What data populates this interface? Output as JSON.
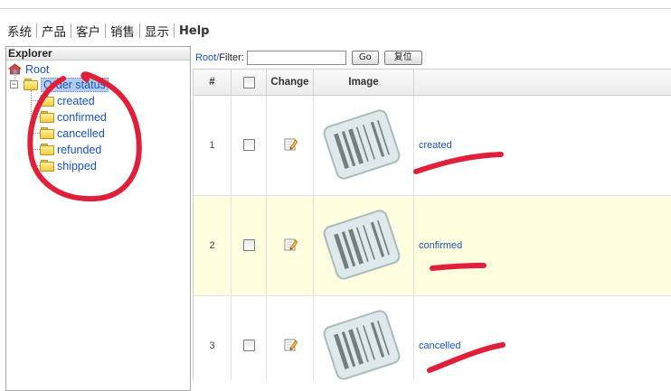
{
  "menu": [
    "系统",
    "产品",
    "客户",
    "销售",
    "显示",
    "Help"
  ],
  "explorer": {
    "title": "Explorer",
    "root": "Root",
    "selected": "Order status",
    "children": [
      "created",
      "confirmed",
      "cancelled",
      "refunded",
      "shipped"
    ]
  },
  "filterbar": {
    "root_link": "Root/",
    "filter_label": "Filter:",
    "filter_value": "",
    "go_label": "Go",
    "reset_label": "复位"
  },
  "grid": {
    "columns": [
      "#",
      "",
      "Change",
      "Image",
      ""
    ],
    "rows": [
      {
        "num": "1",
        "name": "created",
        "checked": false
      },
      {
        "num": "2",
        "name": "confirmed",
        "checked": false
      },
      {
        "num": "3",
        "name": "cancelled",
        "checked": false
      }
    ]
  },
  "colors": {
    "link": "#1a53b8",
    "alt_row": "#ffffe0",
    "annotation": "#e0203a",
    "selected_bg": "#b4ccf0"
  },
  "icons": [
    "root-home-icon",
    "folder-icon",
    "edit-icon",
    "barcode-icon",
    "tree-expander-icon"
  ]
}
